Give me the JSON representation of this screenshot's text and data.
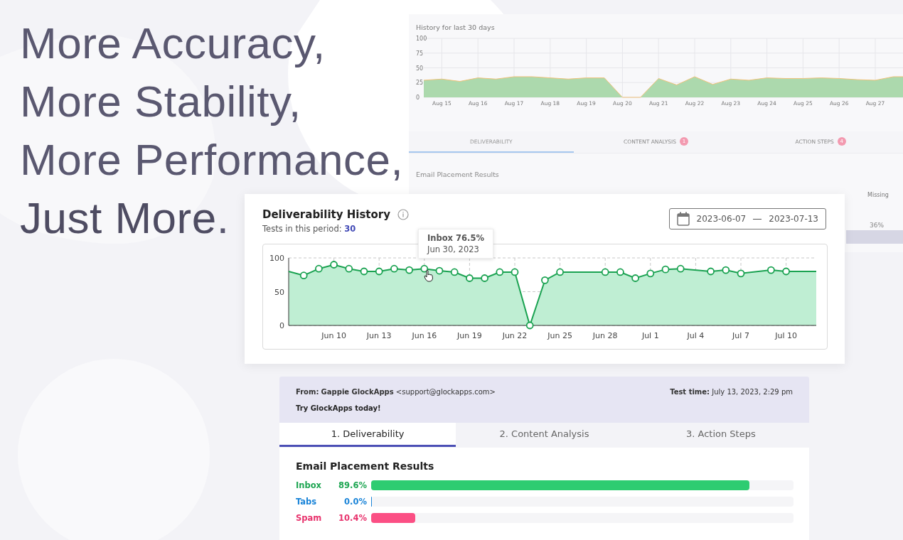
{
  "headline": {
    "lines": [
      "More Accuracy,",
      "More Stability,",
      "More Performance,",
      "**Just More**."
    ]
  },
  "background_report": {
    "chart_title": "History for last 30 days",
    "chart_data": {
      "type": "area",
      "categories": [
        null,
        "Aug 15",
        null,
        "Aug 16",
        null,
        "Aug 17",
        null,
        "Aug 18",
        null,
        "Aug 19",
        null,
        "Aug 20",
        null,
        "Aug 21",
        null,
        "Aug 22",
        null,
        "Aug 23",
        null,
        "Aug 24",
        null,
        "Aug 25",
        null,
        "Aug 26",
        null,
        "Aug 27",
        null,
        null
      ],
      "series": [
        {
          "color": "#acd9ad",
          "values": [
            29,
            31,
            27,
            33,
            31,
            35,
            35,
            33,
            31,
            33,
            33,
            0,
            0,
            32,
            21,
            35,
            22,
            31,
            29,
            33,
            32,
            32,
            33,
            32,
            30,
            29,
            35,
            35
          ]
        }
      ],
      "ylim": [
        0,
        100
      ],
      "yticks": [
        0,
        25,
        50,
        75,
        100
      ],
      "grid": true
    },
    "tabs": [
      {
        "label": "DELIVERABILITY",
        "selected": true
      },
      {
        "label": "CONTENT ANALYSIS",
        "selected": false,
        "badge": "1"
      },
      {
        "label": "ACTION STEPS",
        "selected": false,
        "badge": "4"
      }
    ],
    "section_title": "Email Placement Results",
    "column_header": "Missing",
    "value": "36%"
  },
  "history_card": {
    "title": "Deliverability History",
    "tests_label": "Tests in this period:",
    "tests_count": "30",
    "date_from": "2023-06-07",
    "date_to": "2023-07-13",
    "tooltip": {
      "title": "Inbox 76.5%",
      "date": "Jun 30, 2023"
    },
    "chart_data": {
      "type": "line",
      "categories": [
        null,
        null,
        null,
        "Jun 10",
        null,
        null,
        "Jun 13",
        null,
        null,
        "Jun 16",
        null,
        null,
        "Jun 19",
        null,
        null,
        "Jun 22",
        null,
        null,
        "Jun 25",
        null,
        null,
        "Jun 28",
        null,
        null,
        "Jul 1",
        null,
        null,
        "Jul 4",
        null,
        null,
        "Jul 7",
        null,
        null,
        "Jul 10",
        null,
        null
      ],
      "series": [
        {
          "color": "#1aa251",
          "marker": "circle",
          "values": [
            80,
            74,
            84,
            90,
            84,
            80,
            80,
            84,
            82,
            84,
            81,
            79,
            70,
            70,
            79,
            79,
            0,
            67,
            79,
            null,
            null,
            79,
            79,
            70,
            77,
            83,
            84,
            null,
            80,
            82,
            77,
            null,
            82,
            80,
            80,
            80
          ]
        }
      ],
      "ylim": [
        0,
        100
      ],
      "yticks": [
        0,
        50,
        100
      ],
      "grid": true
    }
  },
  "email": {
    "from_label": "From:",
    "from_name": "Gappie GlockApps",
    "from_address": "<support@glockapps.com>",
    "test_time_label": "Test time:",
    "test_time": "July 13, 2023, 2:29 pm",
    "subject": "Try GlockApps today!"
  },
  "tabs": [
    {
      "label": "1. Deliverability",
      "selected": true
    },
    {
      "label": "2. Content Analysis",
      "selected": false
    },
    {
      "label": "3. Action Steps",
      "selected": false
    }
  ],
  "placement": {
    "title": "Email Placement Results",
    "rows": [
      {
        "name": "Inbox",
        "percent": "89.6%",
        "level": 0.896,
        "color": "#1fa653"
      },
      {
        "name": "Tabs",
        "percent": "0.0%",
        "level": 0.0,
        "color": "#1a84d8"
      },
      {
        "name": "Spam",
        "percent": "10.4%",
        "level": 0.104,
        "color": "#e8336d"
      }
    ]
  }
}
